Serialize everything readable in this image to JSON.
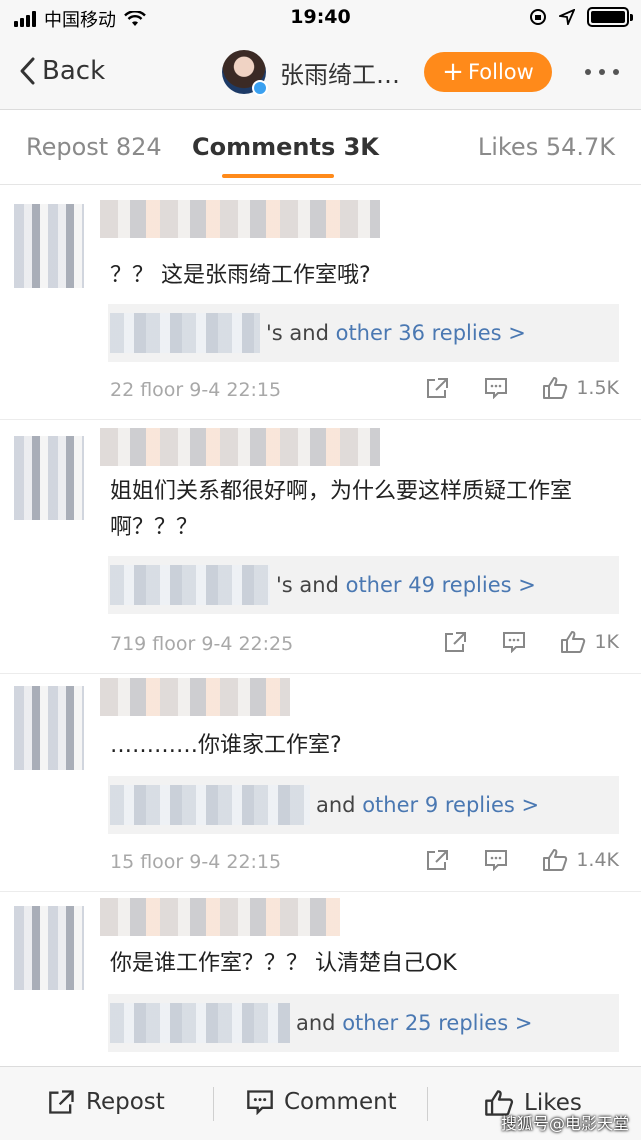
{
  "status_bar": {
    "carrier": "中国移动",
    "time": "19:40"
  },
  "nav": {
    "back_label": "Back",
    "title": "张雨绮工…",
    "follow_label": "Follow"
  },
  "tabs": {
    "repost": "Repost 824",
    "comments": "Comments 3K",
    "likes": "Likes 54.7K"
  },
  "comments": [
    {
      "text": "？？ 这是张雨绮工作室哦?",
      "reply_prefix": "'s and",
      "reply_link": "other 36 replies >",
      "meta": "22 floor 9-4 22:15",
      "likes": "1.5K"
    },
    {
      "text": "姐姐们关系都很好啊，为什么要这样质疑工作室啊？？？",
      "reply_prefix": "'s and",
      "reply_link": "other 49 replies >",
      "meta": "719 floor 9-4 22:25",
      "likes": "1K"
    },
    {
      "text": "…………你谁家工作室?",
      "reply_prefix": "and",
      "reply_link": "other 9 replies >",
      "meta": "15 floor 9-4 22:15",
      "likes": "1.4K"
    },
    {
      "text": "你是谁工作室？？？ 认清楚自己OK",
      "reply_prefix": "and",
      "reply_link": "other 25 replies >"
    }
  ],
  "bottom_bar": {
    "repost": "Repost",
    "comment": "Comment",
    "likes": "Likes"
  },
  "watermark": "搜狐号@电影天堂",
  "colors": {
    "accent": "#ff8a1a",
    "link": "#4a78b2"
  }
}
